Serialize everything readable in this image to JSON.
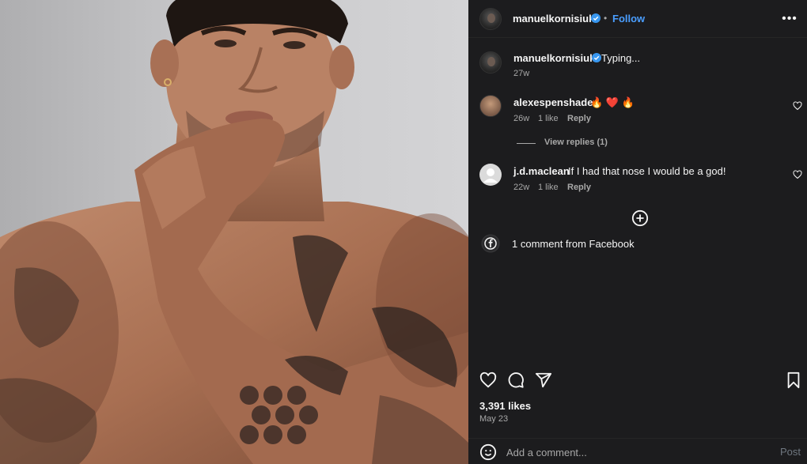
{
  "post": {
    "author": "manuelkornisiuk",
    "follow_label": "Follow",
    "separator": "•",
    "caption_text": "Typing...",
    "caption_age": "27w"
  },
  "comments": [
    {
      "user": "alexespenshade",
      "text": "🔥 ❤️ 🔥",
      "age": "26w",
      "likes": "1 like",
      "reply_label": "Reply",
      "view_replies": "View replies (1)"
    },
    {
      "user": "j.d.maclean",
      "text": "If I had that nose I would be a god!",
      "age": "22w",
      "likes": "1 like",
      "reply_label": "Reply"
    }
  ],
  "facebook_comments": "1 comment from Facebook",
  "likes_count": "3,391 likes",
  "post_date": "May 23",
  "add_comment": {
    "placeholder": "Add a comment...",
    "post_label": "Post"
  },
  "colors": {
    "panel_bg": "#1c1c1e",
    "accent_blue": "#4a9eff",
    "verified_blue": "#3897f0",
    "muted_text": "#a8a8a8"
  },
  "icons": [
    "verified-icon",
    "more-options-icon",
    "heart-icon",
    "comment-icon",
    "share-icon",
    "bookmark-icon",
    "add-circle-icon",
    "facebook-icon",
    "emoji-icon"
  ]
}
